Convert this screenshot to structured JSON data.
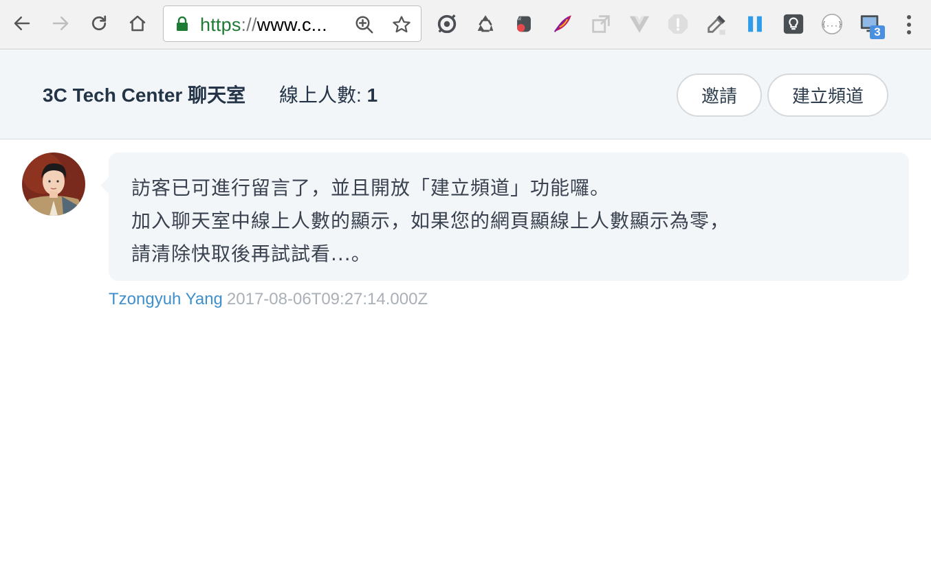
{
  "browser": {
    "url_scheme": "https",
    "url_sep": "://",
    "url_rest": "www.c...",
    "extension_badge": "3",
    "json_ext_label": "{...}"
  },
  "header": {
    "room_title": "3C Tech Center 聊天室",
    "online_label": "線上人數: ",
    "online_count": "1",
    "invite_label": "邀請",
    "create_channel_label": "建立頻道"
  },
  "message": {
    "lines": [
      "訪客已可進行留言了，並且開放「建立頻道」功能囉。",
      "加入聊天室中線上人數的顯示，如果您的網頁顯線上人數顯示為零，",
      "請清除快取後再試試看...。"
    ],
    "author": "Tzongyuh Yang",
    "timestamp": "2017-08-06T09:27:14.000Z"
  },
  "colors": {
    "header_bg": "#f3f6f9",
    "title_text": "#243447",
    "author_link": "#3f8fcb",
    "timestamp": "#aab0b7",
    "secure_green": "#1e7b34"
  },
  "icons": {
    "back": "back-arrow-icon",
    "forward": "forward-arrow-icon",
    "reload": "reload-icon",
    "home": "home-icon",
    "lock": "lock-icon",
    "zoom": "zoom-in-icon",
    "bookmark": "star-icon",
    "menu": "more-vert-icon"
  }
}
